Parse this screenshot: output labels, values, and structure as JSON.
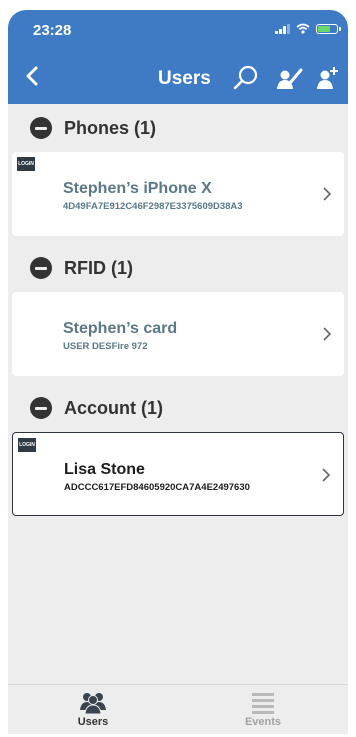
{
  "status_bar": {
    "time": "23:28"
  },
  "header": {
    "title": "Users"
  },
  "sections": [
    {
      "title": "Phones (1)",
      "items": [
        {
          "badge": "LOGIN",
          "name": "Stephen’s iPhone X",
          "sub": "4D49FA7E912C46F2987E3375609D38A3"
        }
      ]
    },
    {
      "title": "RFID (1)",
      "items": [
        {
          "name": "Stephen’s card",
          "sub": "USER DESFire 972"
        }
      ]
    },
    {
      "title": "Account (1)",
      "items": [
        {
          "badge": "LOGIN",
          "name": "Lisa Stone",
          "sub": "ADCCC617EFD84605920CA7A4E2497630"
        }
      ]
    }
  ],
  "tabbar": {
    "users_label": "Users",
    "events_label": "Events"
  },
  "colors": {
    "header": "#3f7bc4",
    "background": "#ededed",
    "card_text": "#5b7887",
    "selected_border": "#2d3440"
  }
}
